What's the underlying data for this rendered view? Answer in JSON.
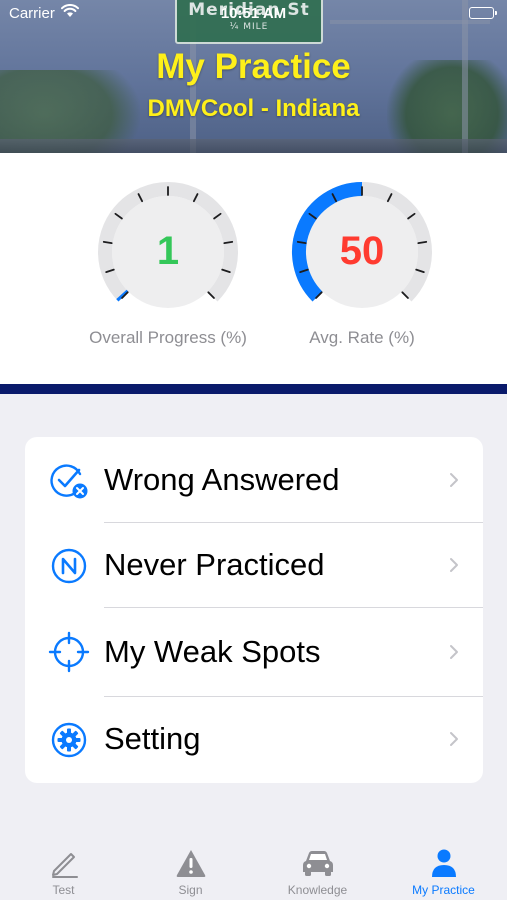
{
  "status_bar": {
    "carrier": "Carrier",
    "time": "10:51 AM"
  },
  "header": {
    "title": "My Practice",
    "subtitle": "DMVCool - Indiana",
    "title_color": "#fef01a",
    "background_sign": {
      "line1": "Meridian St",
      "line2": "¼ MILE"
    }
  },
  "stats": {
    "overall_progress": {
      "value": "1",
      "label": "Overall Progress (%)",
      "percent": 1,
      "value_color": "#34c759"
    },
    "avg_rate": {
      "value": "50",
      "label": "Avg. Rate (%)",
      "percent": 50,
      "value_color": "#ff3b30"
    },
    "gauge_color": "#0a7aff",
    "divider_color": "#0a1a6b"
  },
  "menu": {
    "items": [
      {
        "label": "Wrong Answered",
        "icon": "check-circle-x-icon"
      },
      {
        "label": "Never Practiced",
        "icon": "n-circle-icon"
      },
      {
        "label": "My Weak Spots",
        "icon": "crosshair-icon"
      },
      {
        "label": "Setting",
        "icon": "gear-icon"
      }
    ]
  },
  "tabbar": {
    "accent_color": "#0a7aff",
    "tabs": [
      {
        "label": "Test",
        "icon": "pencil-icon",
        "active": false
      },
      {
        "label": "Sign",
        "icon": "warning-sign-icon",
        "active": false
      },
      {
        "label": "Knowledge",
        "icon": "car-icon",
        "active": false
      },
      {
        "label": "My Practice",
        "icon": "person-icon",
        "active": true
      }
    ]
  }
}
